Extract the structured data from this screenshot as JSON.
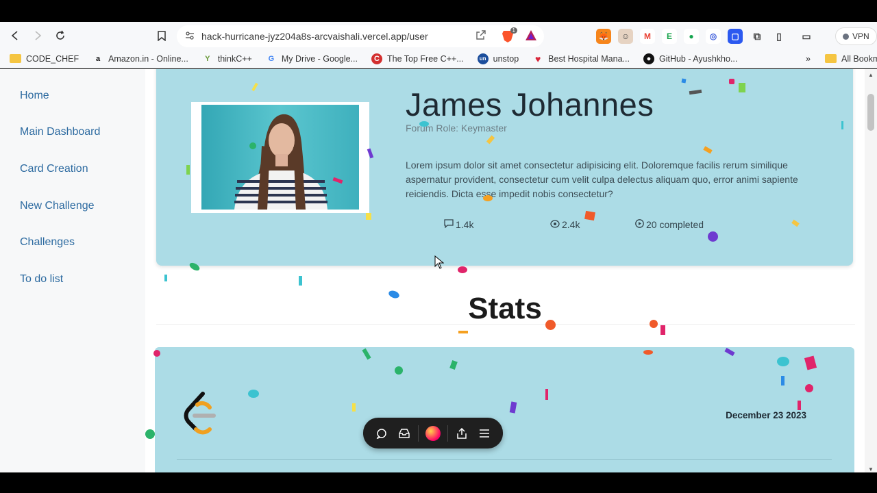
{
  "browser": {
    "url": "hack-hurricane-jyz204a8s-arcvaishali.vercel.app/user",
    "vpn_label": "VPN",
    "brave_badge": "1",
    "bookmarks": [
      {
        "label": "CODE_CHEF",
        "icon": "folder-icon"
      },
      {
        "label": "Amazon.in - Online...",
        "icon": "amazon-icon"
      },
      {
        "label": "thinkC++",
        "icon": "thinkcpp-icon"
      },
      {
        "label": "My Drive - Google...",
        "icon": "google-icon"
      },
      {
        "label": "The Top Free C++...",
        "icon": "cpp-icon"
      },
      {
        "label": "unstop",
        "icon": "unstop-icon"
      },
      {
        "label": "Best Hospital Mana...",
        "icon": "heart-icon"
      },
      {
        "label": "GitHub - Ayushkho...",
        "icon": "github-icon"
      }
    ],
    "more_bookmarks": "»",
    "all_bookmarks": "All Bookm"
  },
  "sidebar": {
    "items": [
      {
        "label": "Home"
      },
      {
        "label": "Main Dashboard"
      },
      {
        "label": "Card Creation"
      },
      {
        "label": "New Challenge"
      },
      {
        "label": "Challenges"
      },
      {
        "label": "To do list"
      }
    ]
  },
  "profile": {
    "name": "James Johannes",
    "role": "Forum Role: Keymaster",
    "bio": "Lorem ipsum dolor sit amet consectetur adipisicing elit. Doloremque facilis rerum similique aspernatur provident, consectetur cum velit culpa delectus aliquam quo, error animi sapiente reiciendis. Dicta esse impedit nobis consectetur?",
    "stats": {
      "comments": "1.4k",
      "views": "2.4k",
      "completed": "20 completed"
    }
  },
  "stats_section": {
    "title": "Stats",
    "date": "December 23 2023"
  },
  "colors": {
    "card_bg": "#acdce6",
    "nav_link": "#2c6aa0",
    "sidebar_bg": "#f7f8f9"
  }
}
